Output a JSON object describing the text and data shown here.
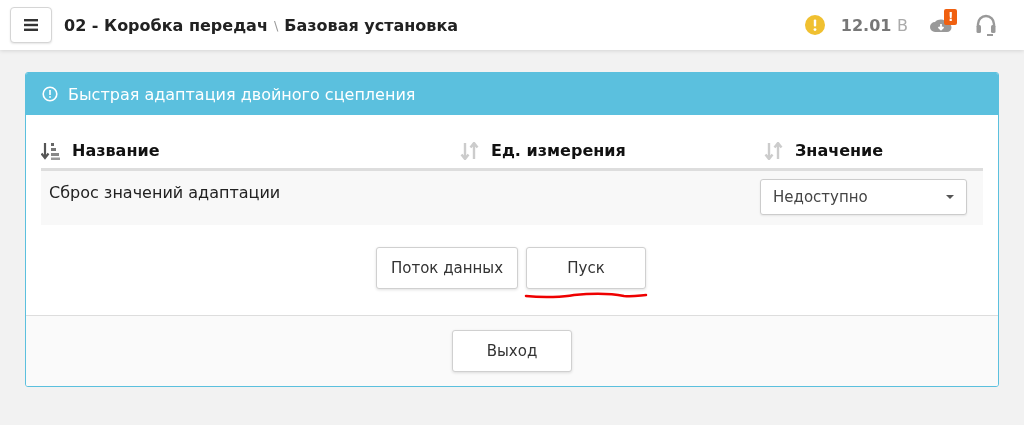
{
  "header": {
    "breadcrumb": [
      {
        "label": "02 - Коробка передач"
      },
      {
        "label": "Базовая установка"
      }
    ],
    "separator": "\\",
    "voltage": {
      "value": "12.01",
      "unit": "В"
    },
    "cloud_badge": "!"
  },
  "panel": {
    "title": "Быстрая адаптация двойного сцепления",
    "table": {
      "columns": [
        {
          "label": "Название",
          "sorted": true
        },
        {
          "label": "Ед. измерения",
          "sorted": false
        },
        {
          "label": "Значение",
          "sorted": false
        }
      ],
      "rows": [
        {
          "name": "Сброс значений адаптации",
          "unit_value": "",
          "select": "Недоступно"
        }
      ]
    },
    "buttons": [
      {
        "label": "Поток данных",
        "underlined": false
      },
      {
        "label": "Пуск",
        "underlined": true
      }
    ],
    "footer_buttons": [
      {
        "label": "Выход"
      }
    ]
  }
}
